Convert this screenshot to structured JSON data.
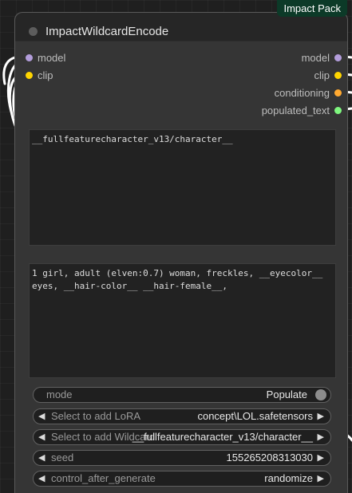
{
  "badge": "Impact Pack",
  "node": {
    "title": "ImpactWildcardEncode",
    "inputs": [
      {
        "label": "model",
        "color": "#b39ddb"
      },
      {
        "label": "clip",
        "color": "#ffd500"
      }
    ],
    "outputs": [
      {
        "label": "model",
        "color": "#b39ddb"
      },
      {
        "label": "clip",
        "color": "#ffd500"
      },
      {
        "label": "conditioning",
        "color": "#ffa931"
      },
      {
        "label": "populated_text",
        "color": "#7ff77f"
      }
    ],
    "wildcard_text": "__fullfeaturecharacter_v13/character__",
    "populated_text": "1 girl, adult (elven:0.7) woman, freckles, __eyecolor__ eyes, __hair-color__ __hair-female__,",
    "widgets": {
      "mode": {
        "name": "mode",
        "value": "Populate"
      },
      "lora": {
        "name": "Select to add LoRA",
        "value": "concept\\LOL.safetensors"
      },
      "wildcard": {
        "name": "Select to add Wildcard",
        "value": "__fullfeaturecharacter_v13/character__"
      },
      "seed": {
        "name": "seed",
        "value": "155265208313030"
      },
      "control": {
        "name": "control_after_generate",
        "value": "randomize"
      }
    }
  },
  "arrows": {
    "left": "◀",
    "right": "▶"
  }
}
